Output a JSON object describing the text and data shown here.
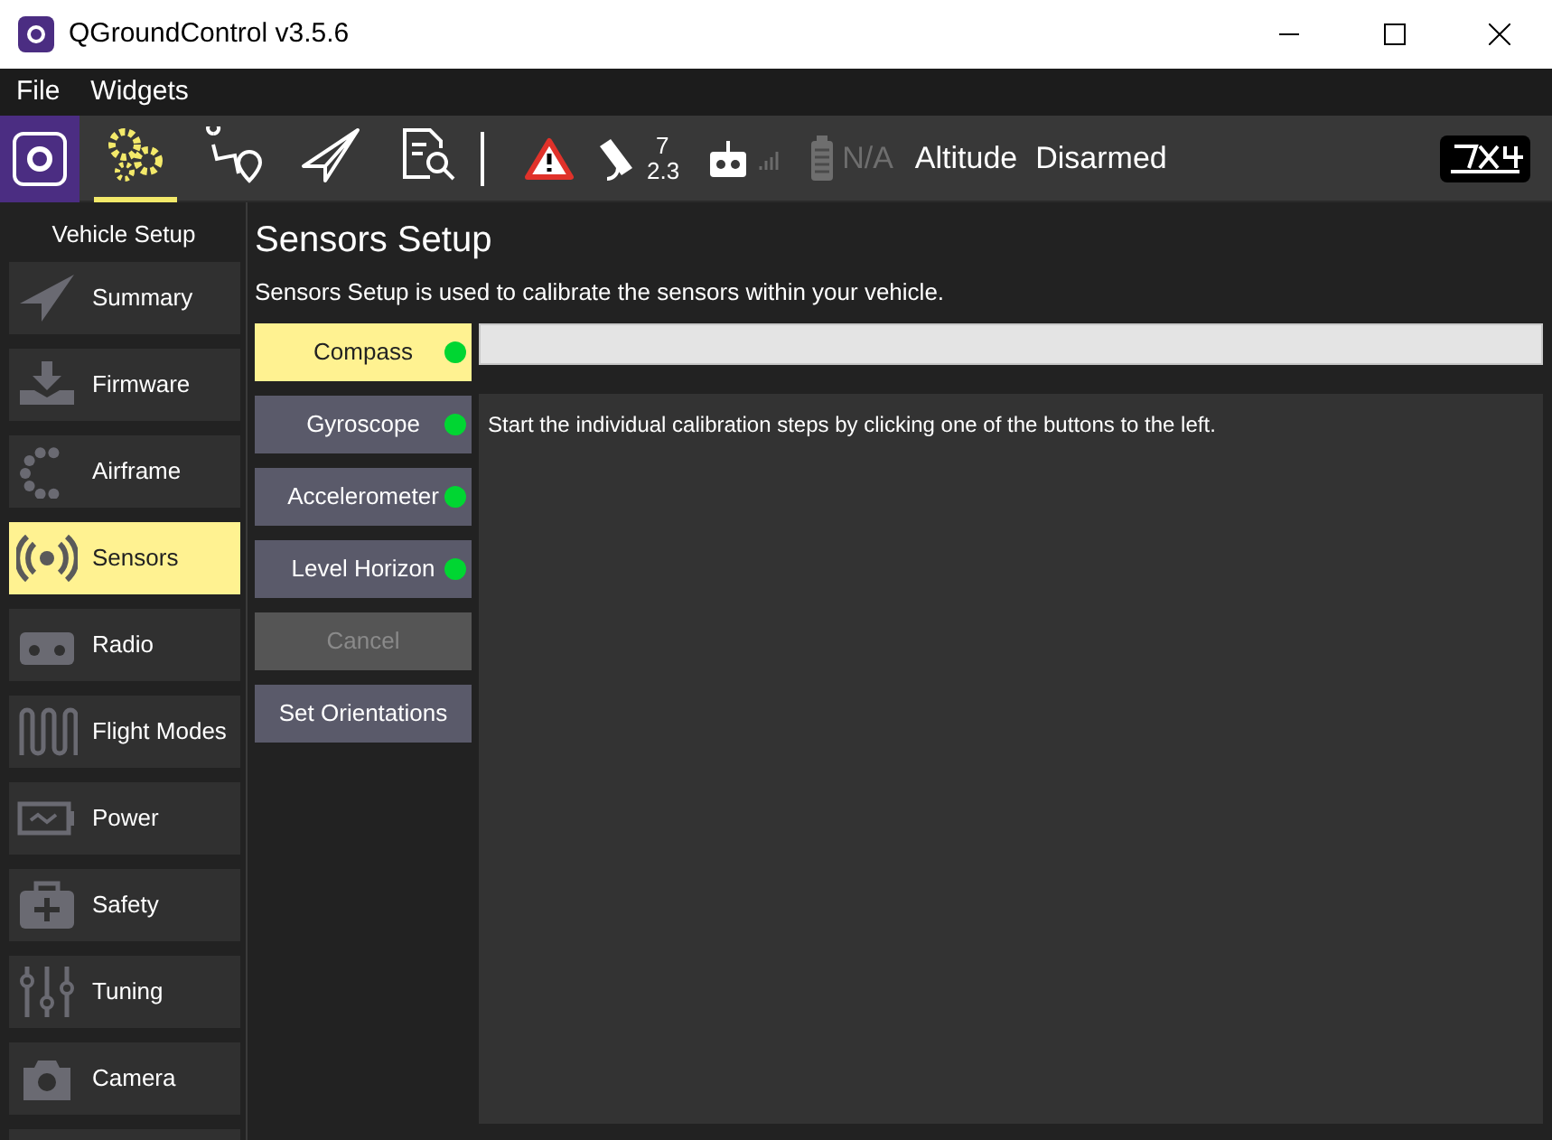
{
  "window": {
    "title": "QGroundControl v3.5.6"
  },
  "menu": [
    "File",
    "Widgets"
  ],
  "toolbar": {
    "tools": [
      {
        "kind": "setup",
        "selected": true
      },
      {
        "kind": "plan",
        "selected": false
      },
      {
        "kind": "fly",
        "selected": false
      },
      {
        "kind": "analyze",
        "selected": false
      }
    ],
    "gps_count": "7",
    "gps_hdop": "2.3",
    "battery": "N/A",
    "altitude": "Altitude",
    "arm_state": "Disarmed"
  },
  "sidebar": {
    "title": "Vehicle Setup",
    "items": [
      {
        "label": "Summary",
        "kind": "summary",
        "selected": false
      },
      {
        "label": "Firmware",
        "kind": "firmware",
        "selected": false
      },
      {
        "label": "Airframe",
        "kind": "airframe",
        "selected": false
      },
      {
        "label": "Sensors",
        "kind": "sensors",
        "selected": true
      },
      {
        "label": "Radio",
        "kind": "radio",
        "selected": false
      },
      {
        "label": "Flight Modes",
        "kind": "modes",
        "selected": false
      },
      {
        "label": "Power",
        "kind": "power",
        "selected": false
      },
      {
        "label": "Safety",
        "kind": "safety",
        "selected": false
      },
      {
        "label": "Tuning",
        "kind": "tuning",
        "selected": false
      },
      {
        "label": "Camera",
        "kind": "camera",
        "selected": false
      }
    ]
  },
  "page": {
    "title": "Sensors Setup",
    "description": "Sensors Setup is used to calibrate the sensors within your vehicle.",
    "buttons": [
      {
        "label": "Compass",
        "kind": "sensor",
        "selected": true,
        "calibrated": true
      },
      {
        "label": "Gyroscope",
        "kind": "sensor",
        "selected": false,
        "calibrated": true
      },
      {
        "label": "Accelerometer",
        "kind": "sensor",
        "selected": false,
        "calibrated": true
      },
      {
        "label": "Level Horizon",
        "kind": "sensor",
        "selected": false,
        "calibrated": true
      },
      {
        "label": "Cancel",
        "kind": "action",
        "disabled": true
      },
      {
        "label": "Set Orientations",
        "kind": "action",
        "disabled": false
      }
    ],
    "progress": {
      "level": 0
    },
    "instructions": "Start the individual calibration steps by clicking one of the buttons to the left."
  }
}
